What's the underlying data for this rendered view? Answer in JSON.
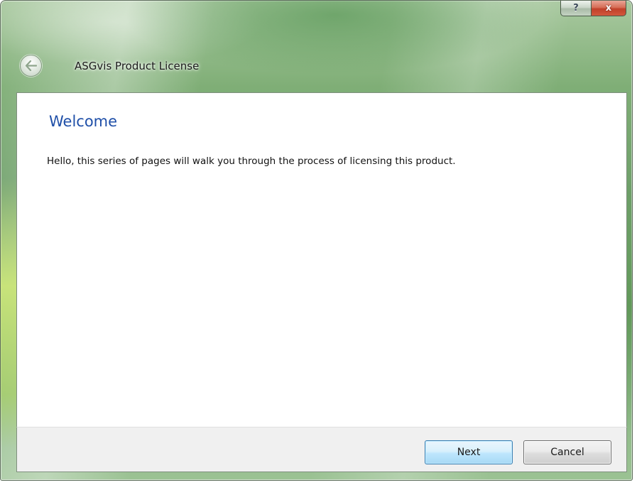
{
  "window": {
    "title": "ASGvis Product License"
  },
  "caption_buttons": {
    "help_label": "?",
    "close_label": "x"
  },
  "page": {
    "heading": "Welcome",
    "body": "Hello, this series of pages will walk you through the process of licensing this product."
  },
  "footer": {
    "next_label": "Next",
    "cancel_label": "Cancel"
  },
  "icons": {
    "back": "back-arrow-icon",
    "help": "question-mark-icon",
    "close": "close-icon"
  },
  "colors": {
    "heading": "#1f4fa8",
    "frame_accent": "#7fae76",
    "primary_button_border": "#3c7fb1",
    "close_button": "#c1412a"
  }
}
